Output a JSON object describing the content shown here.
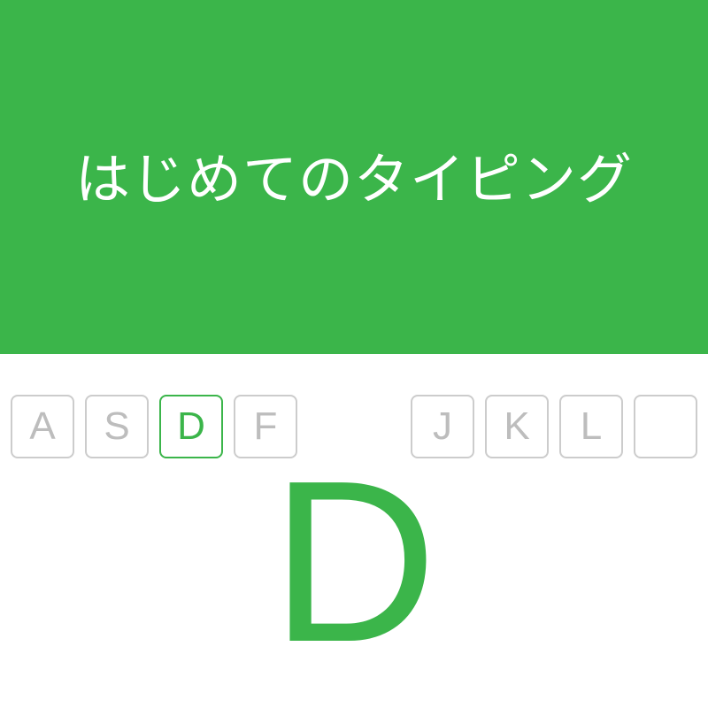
{
  "header": {
    "title": "はじめてのタイピング"
  },
  "keyboard": {
    "left_keys": [
      {
        "label": "A",
        "active": false
      },
      {
        "label": "S",
        "active": false
      },
      {
        "label": "D",
        "active": true
      },
      {
        "label": "F",
        "active": false
      }
    ],
    "right_keys": [
      {
        "label": "J",
        "active": false
      },
      {
        "label": "K",
        "active": false
      },
      {
        "label": "L",
        "active": false
      },
      {
        "label": "",
        "active": false
      }
    ]
  },
  "target": {
    "letter": "D"
  },
  "colors": {
    "accent": "#3bb54a",
    "key_border": "#cccccc",
    "key_text": "#bdbdbd",
    "background": "#ffffff"
  }
}
